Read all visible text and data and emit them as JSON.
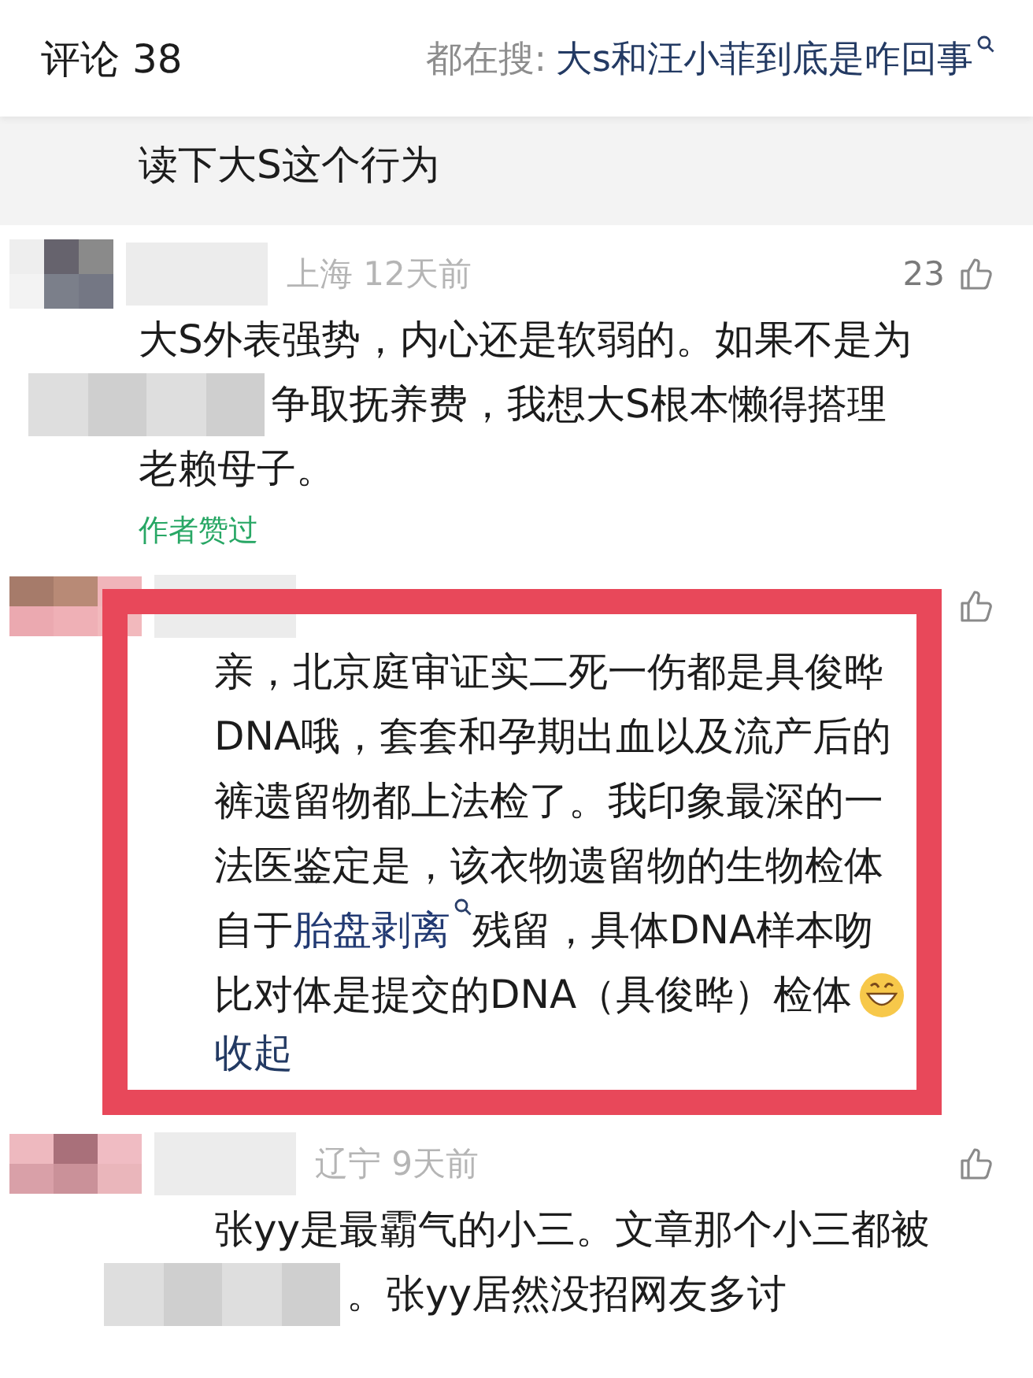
{
  "header": {
    "title": "评论 38",
    "search_prefix": "都在搜:",
    "search_query": "大s和汪小菲到底是咋回事"
  },
  "snippet": {
    "lines": [
      "读下大S这个行为"
    ]
  },
  "comments": [
    {
      "kind": "top",
      "meta": "上海 12天前",
      "likes": "23",
      "highlighted": false,
      "lines": [
        [
          {
            "kind": "plain",
            "text": "大S外表强势，内心还是软弱的。如果不是为"
          }
        ],
        [
          {
            "kind": "masked"
          },
          {
            "kind": "plain",
            "text": "争取抚养费，我想大S根本懒得搭理"
          }
        ],
        [
          {
            "kind": "plain",
            "text": "老赖母子。"
          }
        ]
      ],
      "badge": "作者赞过"
    },
    {
      "kind": "reply",
      "highlighted": true,
      "lines": [
        [
          {
            "kind": "plain",
            "text": "亲，北京庭审证实二死一伤都是具俊晔"
          }
        ],
        [
          {
            "kind": "plain",
            "text": "DNA哦，套套和孕期出血以及流产后的"
          }
        ],
        [
          {
            "kind": "plain",
            "text": "裤遗留物都上法检了。我印象最深的一"
          }
        ],
        [
          {
            "kind": "plain",
            "text": "法医鉴定是，该衣物遗留物的生物检体"
          }
        ],
        [
          {
            "kind": "plain",
            "text": "自于"
          },
          {
            "kind": "link",
            "text": "胎盘剥离"
          },
          {
            "kind": "plain",
            "text": "残留，具体DNA样本吻"
          }
        ],
        [
          {
            "kind": "plain",
            "text": "比对体是提交的DNA（具俊晔）检体"
          },
          {
            "kind": "emoji"
          }
        ]
      ],
      "collapse": "收起"
    },
    {
      "kind": "reply",
      "meta": "辽宁 9天前",
      "highlighted": false,
      "lines": [
        [
          {
            "kind": "plain",
            "text": "张yy是最霸气的小三。文章那个小三都被"
          }
        ],
        [
          {
            "kind": "masked"
          },
          {
            "kind": "plain",
            "text": "。张yy居然没招网友多讨"
          }
        ]
      ]
    }
  ]
}
